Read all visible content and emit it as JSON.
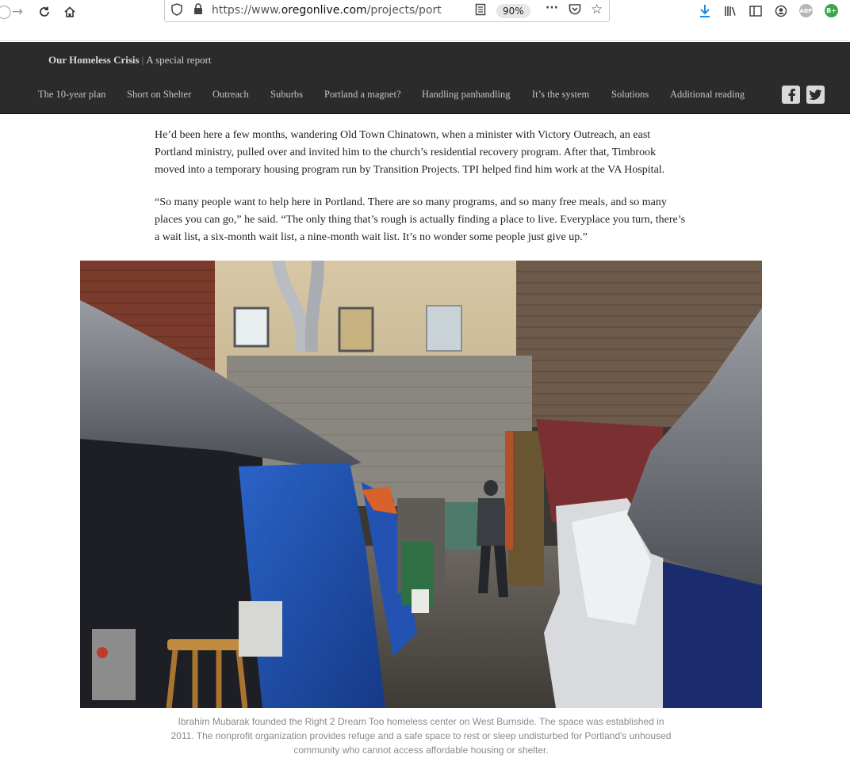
{
  "browser": {
    "url_prefix": "https://www.",
    "url_domain": "oregonlive.com",
    "url_path": "/projects/portland-h",
    "zoom": "90%",
    "extension_abp": "ABP",
    "extension_b": "B+"
  },
  "header": {
    "title_bold": "Our Homeless Crisis",
    "separator": "|",
    "subtitle": "A special report",
    "nav": [
      {
        "label": "The 10-year plan"
      },
      {
        "label": "Short on Shelter"
      },
      {
        "label": "Outreach"
      },
      {
        "label": "Suburbs"
      },
      {
        "label": "Portland a magnet?"
      },
      {
        "label": "Handling panhandling"
      },
      {
        "label": "It’s the system"
      },
      {
        "label": "Solutions"
      },
      {
        "label": "Additional reading"
      }
    ],
    "social": [
      "facebook-icon",
      "twitter-icon"
    ]
  },
  "article": {
    "paragraphs": [
      "He’d been here a few months, wandering Old Town Chinatown, when a minister with Victory Outreach, an east Portland ministry, pulled over and invited him to the church’s residential recovery program. After that, Timbrook moved into a temporary housing program run by Transition Projects. TPI helped find him work at the VA Hospital.",
      "“So many people want to help here in Portland. There are so many programs, and so many free meals, and so many places you can go,” he said. “The only thing that’s rough is actually finding a place to live. Everyplace you turn, there’s a wait list, a six-month wait list, a nine-month wait list. It’s no wonder some people just give up.”"
    ],
    "caption": "Ibrahim Mubarak founded the Right 2 Dream Too homeless center on West Burnside. The space was established in 2011. The nonprofit organization provides refuge and a safe space to rest or sleep undisturbed for Portland's unhoused community who cannot access affordable housing or shelter."
  }
}
